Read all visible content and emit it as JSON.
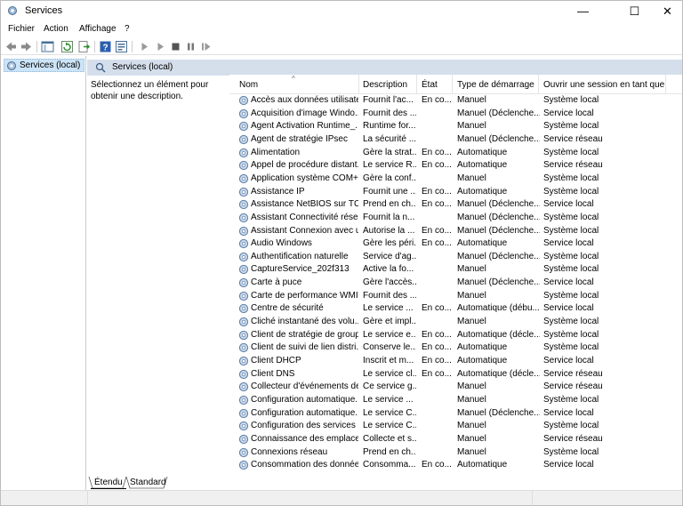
{
  "window": {
    "title": "Services",
    "minimize_glyph": "—",
    "maximize_glyph": "☐",
    "close_glyph": "✕"
  },
  "menu": {
    "items": [
      "Fichier",
      "Action",
      "Affichage",
      "?"
    ]
  },
  "toolbar": {
    "icons": [
      "back-icon",
      "forward-icon",
      "show-hide-tree-icon",
      "refresh-icon",
      "export-icon",
      "help-icon",
      "properties-icon",
      "start-icon",
      "start-alt-icon",
      "stop-icon",
      "pause-icon",
      "restart-icon"
    ]
  },
  "tree": {
    "item": "Services (local)"
  },
  "pane": {
    "header": "Services (local)",
    "description": "Sélectionnez un élément pour obtenir une description."
  },
  "list": {
    "columns": [
      "Nom",
      "Description",
      "État",
      "Type de démarrage",
      "Ouvrir une session en tant que"
    ],
    "rows": [
      [
        "Accès aux données utilisate...",
        "Fournit l'ac...",
        "En co...",
        "Manuel",
        "Système local"
      ],
      [
        "Acquisition d'image Windo...",
        "Fournit des ...",
        "",
        "Manuel (Déclenche...",
        "Service local"
      ],
      [
        "Agent Activation Runtime_...",
        "Runtime for...",
        "",
        "Manuel",
        "Système local"
      ],
      [
        "Agent de stratégie IPsec",
        "La sécurité ...",
        "",
        "Manuel (Déclenche...",
        "Service réseau"
      ],
      [
        "Alimentation",
        "Gère la strat...",
        "En co...",
        "Automatique",
        "Système local"
      ],
      [
        "Appel de procédure distant...",
        "Le service R...",
        "En co...",
        "Automatique",
        "Service réseau"
      ],
      [
        "Application système COM+",
        "Gère la conf...",
        "",
        "Manuel",
        "Système local"
      ],
      [
        "Assistance IP",
        "Fournit une ...",
        "En co...",
        "Automatique",
        "Système local"
      ],
      [
        "Assistance NetBIOS sur TCP...",
        "Prend en ch...",
        "En co...",
        "Manuel (Déclenche...",
        "Service local"
      ],
      [
        "Assistant Connectivité réseau",
        "Fournit la n...",
        "",
        "Manuel (Déclenche...",
        "Système local"
      ],
      [
        "Assistant Connexion avec u...",
        "Autorise la ...",
        "En co...",
        "Manuel (Déclenche...",
        "Système local"
      ],
      [
        "Audio Windows",
        "Gère les péri...",
        "En co...",
        "Automatique",
        "Service local"
      ],
      [
        "Authentification naturelle",
        "Service d'ag...",
        "",
        "Manuel (Déclenche...",
        "Système local"
      ],
      [
        "CaptureService_202f313",
        "Active la fo...",
        "",
        "Manuel",
        "Système local"
      ],
      [
        "Carte à puce",
        "Gère l'accès...",
        "",
        "Manuel (Déclenche...",
        "Service local"
      ],
      [
        "Carte de performance WMI",
        "Fournit des ...",
        "",
        "Manuel",
        "Système local"
      ],
      [
        "Centre de sécurité",
        "Le service ...",
        "En co...",
        "Automatique (débu...",
        "Service local"
      ],
      [
        "Cliché instantané des volu...",
        "Gère et impl...",
        "",
        "Manuel",
        "Système local"
      ],
      [
        "Client de stratégie de groupe",
        "Le service e...",
        "En co...",
        "Automatique (décle...",
        "Système local"
      ],
      [
        "Client de suivi de lien distri...",
        "Conserve le...",
        "En co...",
        "Automatique",
        "Système local"
      ],
      [
        "Client DHCP",
        "Inscrit et m...",
        "En co...",
        "Automatique",
        "Service local"
      ],
      [
        "Client DNS",
        "Le service cl...",
        "En co...",
        "Automatique (décle...",
        "Service réseau"
      ],
      [
        "Collecteur d'événements de...",
        "Ce service g...",
        "",
        "Manuel",
        "Service réseau"
      ],
      [
        "Configuration automatique...",
        "Le service ...",
        "",
        "Manuel",
        "Système local"
      ],
      [
        "Configuration automatique...",
        "Le service C...",
        "",
        "Manuel (Déclenche...",
        "Service local"
      ],
      [
        "Configuration des services ...",
        "Le service C...",
        "",
        "Manuel",
        "Système local"
      ],
      [
        "Connaissance des emplace...",
        "Collecte et s...",
        "",
        "Manuel",
        "Service réseau"
      ],
      [
        "Connexions réseau",
        "Prend en ch...",
        "",
        "Manuel",
        "Système local"
      ],
      [
        "Consommation des données",
        "Consomma...",
        "En co...",
        "Automatique",
        "Service local"
      ]
    ]
  },
  "tabs": [
    "Étendu",
    "Standard"
  ]
}
